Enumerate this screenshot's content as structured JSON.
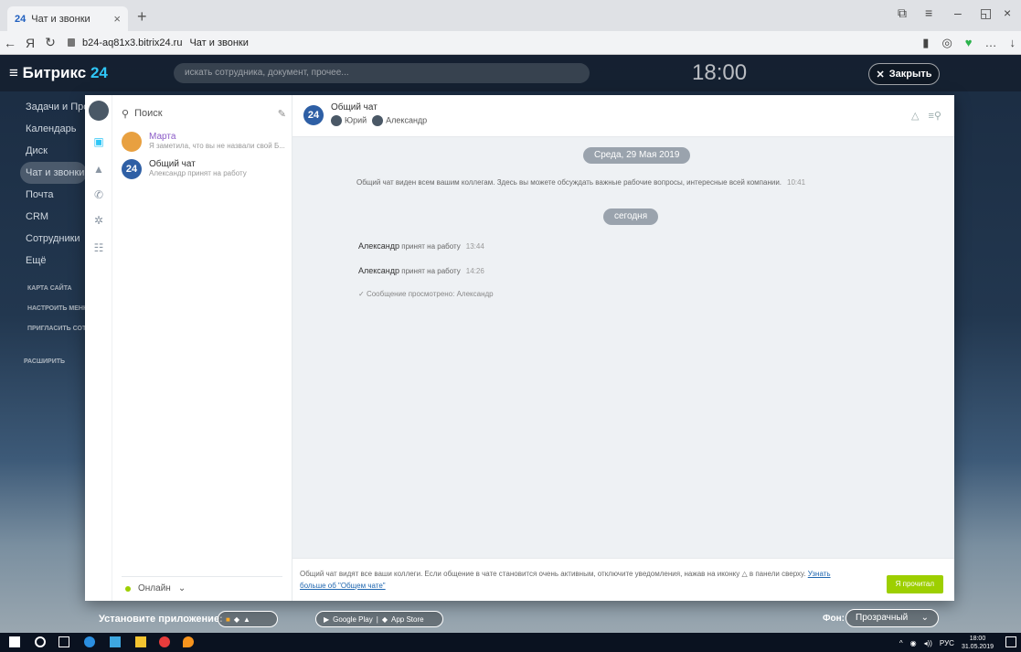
{
  "browser": {
    "tab_title": "Чат и звонки",
    "tab_logo": "24",
    "url_domain": "b24-aq81x3.bitrix24.ru",
    "url_title": "Чат и звонки"
  },
  "portal": {
    "brand": "Битрикс",
    "brand_num": "24",
    "search_placeholder": "искать сотрудника, документ, прочее...",
    "clock": "18:00",
    "close_label": "Закрыть",
    "nav": [
      "Задачи и Проекты",
      "Календарь",
      "Диск",
      "Чат и звонки",
      "Почта",
      "CRM",
      "Сотрудники",
      "Ещё"
    ],
    "nav_small": [
      "КАРТА САЙТА",
      "НАСТРОИТЬ МЕНЮ",
      "ПРИГЛАСИТЬ СОТРУДНИКОВ"
    ],
    "extend_label": "РАСШИРИТЬ"
  },
  "recent": {
    "search_placeholder": "Поиск",
    "items": [
      {
        "name": "Марта",
        "message": "Я заметила, что вы не назвали свой Б..."
      },
      {
        "name": "Общий чат",
        "message": "Александр принят на работу"
      }
    ],
    "status": "Онлайн"
  },
  "chat": {
    "title": "Общий чат",
    "members": [
      "Юрий",
      "Александр"
    ],
    "date_pill_1": "Среда, 29 Мая 2019",
    "system_message": "Общий чат виден всем вашим коллегам. Здесь вы можете обсуждать важные рабочие вопросы, интересные всей компании.",
    "system_time": "10:41",
    "date_pill_2": "сегодня",
    "events": [
      {
        "name": "Александр",
        "text": "принят на работу",
        "time": "13:44"
      },
      {
        "name": "Александр",
        "text": "принят на работу",
        "time": "14:26"
      }
    ],
    "viewed": "Сообщение просмотрено: Александр",
    "notice_text": "Общий чат видят все ваши коллеги. Если общение в чате становится очень активным, отключите уведомления, нажав на иконку",
    "notice_text_2": "в панели сверху.",
    "notice_link": "Узнать больше об \"Общем чате\"",
    "read_button": "Я прочитал"
  },
  "appbar": {
    "label": "Установите приложение:",
    "google_play": "Google Play",
    "app_store": "App Store",
    "bg_label": "Фон:",
    "bg_value": "Прозрачный"
  },
  "taskbar": {
    "lang": "РУС",
    "time": "18:00",
    "date": "31.05.2019"
  }
}
